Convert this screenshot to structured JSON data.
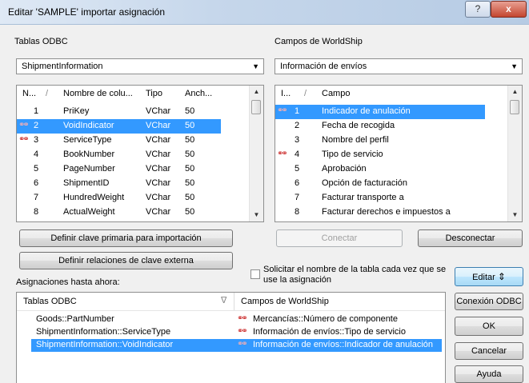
{
  "window": {
    "title": "Editar 'SAMPLE' importar asignación",
    "help_label": "?",
    "close_label": "x"
  },
  "odbc": {
    "label": "Tablas ODBC",
    "selected": "ShipmentInformation",
    "headers": [
      "N...",
      "Nombre de colu...",
      "Tipo",
      "Anch..."
    ],
    "rows": [
      {
        "num": "1",
        "name": "PriKey",
        "type": "VChar",
        "width": "50",
        "linked": false,
        "selected": false
      },
      {
        "num": "2",
        "name": "VoidIndicator",
        "type": "VChar",
        "width": "50",
        "linked": true,
        "selected": true
      },
      {
        "num": "3",
        "name": "ServiceType",
        "type": "VChar",
        "width": "50",
        "linked": true,
        "selected": false
      },
      {
        "num": "4",
        "name": "BookNumber",
        "type": "VChar",
        "width": "50",
        "linked": false,
        "selected": false
      },
      {
        "num": "5",
        "name": "PageNumber",
        "type": "VChar",
        "width": "50",
        "linked": false,
        "selected": false
      },
      {
        "num": "6",
        "name": "ShipmentID",
        "type": "VChar",
        "width": "50",
        "linked": false,
        "selected": false
      },
      {
        "num": "7",
        "name": "HundredWeight",
        "type": "VChar",
        "width": "50",
        "linked": false,
        "selected": false
      },
      {
        "num": "8",
        "name": "ActualWeight",
        "type": "VChar",
        "width": "50",
        "linked": false,
        "selected": false
      }
    ]
  },
  "worldship": {
    "label": "Campos de WorldShip",
    "selected": "Información de envíos",
    "headers": [
      "I...",
      "Campo"
    ],
    "rows": [
      {
        "num": "1",
        "name": "Indicador de anulación",
        "linked": true,
        "selected": true
      },
      {
        "num": "2",
        "name": "Fecha de recogida",
        "linked": false,
        "selected": false
      },
      {
        "num": "3",
        "name": "Nombre del perfil",
        "linked": false,
        "selected": false
      },
      {
        "num": "4",
        "name": "Tipo de servicio",
        "linked": true,
        "selected": false
      },
      {
        "num": "5",
        "name": "Aprobación",
        "linked": false,
        "selected": false
      },
      {
        "num": "6",
        "name": "Opción de facturación",
        "linked": false,
        "selected": false
      },
      {
        "num": "7",
        "name": "Facturar transporte a",
        "linked": false,
        "selected": false
      },
      {
        "num": "8",
        "name": "Facturar derechos e impuestos a",
        "linked": false,
        "selected": false
      }
    ]
  },
  "buttons": {
    "primary_key": "Definir clave primaria para importación",
    "foreign_key": "Definir relaciones de clave externa",
    "connect": "Conectar",
    "disconnect": "Desconectar",
    "edit": "Editar",
    "odbc_connection": "Conexión ODBC",
    "ok": "OK",
    "cancel": "Cancelar",
    "help": "Ayuda"
  },
  "prompt_checkbox": {
    "label_line1": "Solicitar el nombre de la tabla cada vez que se",
    "label_line2": "use la asignación",
    "checked": false
  },
  "mappings": {
    "label": "Asignaciones hasta ahora:",
    "headers": [
      "Tablas ODBC",
      "Campos de WorldShip"
    ],
    "rows": [
      {
        "odbc": "Goods::PartNumber",
        "worldship": "Mercancías::Número de componente",
        "selected": false
      },
      {
        "odbc": "ShipmentInformation::ServiceType",
        "worldship": "Información de envíos::Tipo de servicio",
        "selected": false
      },
      {
        "odbc": "ShipmentInformation::VoidIndicator",
        "worldship": "Información de envíos::Indicador de anulación",
        "selected": true
      }
    ]
  },
  "icons": {
    "link": "link-chain-icon",
    "sort": "sort-icon",
    "dropdown": "chevron-down-icon"
  }
}
